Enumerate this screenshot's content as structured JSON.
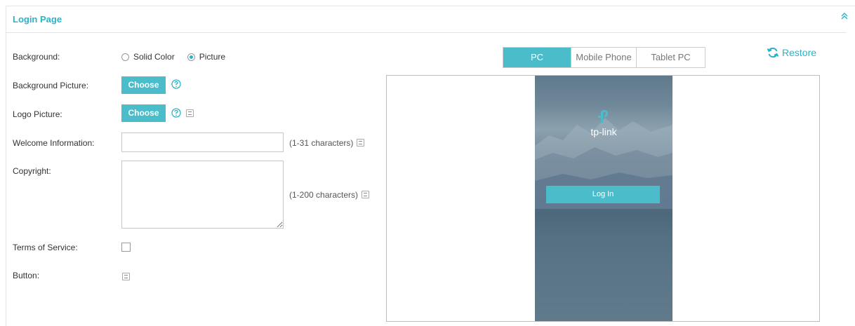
{
  "panel": {
    "title": "Login Page"
  },
  "form": {
    "background_label": "Background:",
    "background_options": [
      "Solid Color",
      "Picture"
    ],
    "background_selected": "Picture",
    "background_picture_label": "Background Picture:",
    "logo_picture_label": "Logo Picture:",
    "choose_label": "Choose",
    "welcome_label": "Welcome Information:",
    "welcome_value": "",
    "welcome_hint": "(1-31 characters)",
    "copyright_label": "Copyright:",
    "copyright_value": "",
    "copyright_hint": "(1-200 characters)",
    "terms_label": "Terms of Service:",
    "terms_checked": false,
    "button_label": "Button:"
  },
  "preview": {
    "tabs": [
      "PC",
      "Mobile Phone",
      "Tablet PC"
    ],
    "active_tab": "PC",
    "restore_label": "Restore",
    "brand_text": "tp-link",
    "login_button": "Log In"
  },
  "colors": {
    "accent": "#4bbdca",
    "title": "#2ab3c7"
  }
}
